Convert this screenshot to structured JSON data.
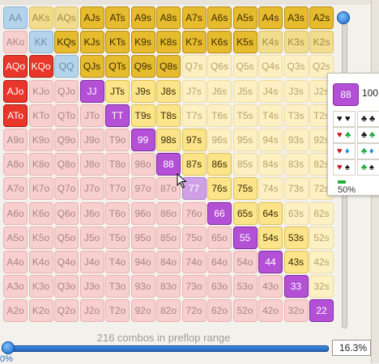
{
  "ranks": [
    "A",
    "K",
    "Q",
    "J",
    "T",
    "9",
    "8",
    "7",
    "6",
    "5",
    "4",
    "3",
    "2"
  ],
  "cells": [
    [
      [
        "AA",
        "blue",
        0
      ],
      [
        "AKs",
        "gold-faded",
        0
      ],
      [
        "AQs",
        "gold-faded",
        0
      ],
      [
        "AJs",
        "gold",
        0
      ],
      [
        "ATs",
        "gold",
        0
      ],
      [
        "A9s",
        "gold",
        0
      ],
      [
        "A8s",
        "gold",
        0
      ],
      [
        "A7s",
        "gold",
        0
      ],
      [
        "A6s",
        "gold",
        0
      ],
      [
        "A5s",
        "gold",
        1
      ],
      [
        "A4s",
        "gold",
        1
      ],
      [
        "A3s",
        "gold",
        1
      ],
      [
        "A2s",
        "gold",
        1
      ]
    ],
    [
      [
        "AKo",
        "pink",
        0
      ],
      [
        "KK",
        "blue",
        0
      ],
      [
        "KQs",
        "gold",
        1
      ],
      [
        "KJs",
        "gold",
        1
      ],
      [
        "KTs",
        "gold",
        1
      ],
      [
        "K9s",
        "gold",
        1
      ],
      [
        "K8s",
        "gold",
        1
      ],
      [
        "K7s",
        "gold",
        1
      ],
      [
        "K6s",
        "gold",
        1
      ],
      [
        "K5s",
        "gold",
        1
      ],
      [
        "K4s",
        "gold-faded",
        0
      ],
      [
        "K3s",
        "gold-faded",
        0
      ],
      [
        "K2s",
        "gold-faded",
        0
      ]
    ],
    [
      [
        "AQo",
        "raise",
        0
      ],
      [
        "KQo",
        "raise",
        0
      ],
      [
        "QQ",
        "blue",
        0
      ],
      [
        "QJs",
        "gold",
        1
      ],
      [
        "QTs",
        "gold",
        1
      ],
      [
        "Q9s",
        "gold",
        1
      ],
      [
        "Q8s",
        "gold",
        1
      ],
      [
        "Q7s",
        "yellow-faded",
        0
      ],
      [
        "Q6s",
        "yellow-faded",
        0
      ],
      [
        "Q5s",
        "yellow-faded",
        0
      ],
      [
        "Q4s",
        "yellow-faded",
        0
      ],
      [
        "Q3s",
        "yellow-faded",
        0
      ],
      [
        "Q2s",
        "yellow-faded",
        0
      ]
    ],
    [
      [
        "AJo",
        "raise",
        0
      ],
      [
        "KJo",
        "pink",
        0
      ],
      [
        "QJo",
        "pink",
        0
      ],
      [
        "JJ",
        "purple",
        0
      ],
      [
        "JTs",
        "yellow",
        1
      ],
      [
        "J9s",
        "yellow",
        1
      ],
      [
        "J8s",
        "yellow",
        1
      ],
      [
        "J7s",
        "yellow-faded",
        0
      ],
      [
        "J6s",
        "yellow-faded",
        0
      ],
      [
        "J5s",
        "yellow-faded",
        0
      ],
      [
        "J4s",
        "yellow-faded",
        0
      ],
      [
        "J3s",
        "yellow-faded",
        0
      ],
      [
        "J2s",
        "yellow-faded",
        0
      ]
    ],
    [
      [
        "ATo",
        "raise",
        0
      ],
      [
        "KTo",
        "pink",
        0
      ],
      [
        "QTo",
        "pink",
        0
      ],
      [
        "JTo",
        "pink",
        0
      ],
      [
        "TT",
        "purple",
        0
      ],
      [
        "T9s",
        "yellow",
        0
      ],
      [
        "T8s",
        "yellow",
        0
      ],
      [
        "T7s",
        "yellow-faded",
        0
      ],
      [
        "T6s",
        "yellow-faded",
        0
      ],
      [
        "T5s",
        "yellow-faded",
        0
      ],
      [
        "T4s",
        "yellow-faded",
        0
      ],
      [
        "T3s",
        "yellow-faded",
        0
      ],
      [
        "T2s",
        "yellow-faded",
        0
      ]
    ],
    [
      [
        "A9o",
        "pink",
        0
      ],
      [
        "K9o",
        "pink",
        0
      ],
      [
        "Q9o",
        "pink",
        0
      ],
      [
        "J9o",
        "pink",
        0
      ],
      [
        "T9o",
        "pink",
        0
      ],
      [
        "99",
        "purple",
        0
      ],
      [
        "98s",
        "yellow",
        0
      ],
      [
        "97s",
        "yellow",
        0
      ],
      [
        "96s",
        "yellow-faded",
        0
      ],
      [
        "95s",
        "yellow-faded",
        0
      ],
      [
        "94s",
        "yellow-faded",
        0
      ],
      [
        "93s",
        "yellow-faded",
        0
      ],
      [
        "92s",
        "yellow-faded",
        0
      ]
    ],
    [
      [
        "A8o",
        "pink",
        0
      ],
      [
        "K8o",
        "pink",
        0
      ],
      [
        "Q8o",
        "pink",
        0
      ],
      [
        "J8o",
        "pink",
        0
      ],
      [
        "T8o",
        "pink",
        0
      ],
      [
        "98o",
        "pink",
        0
      ],
      [
        "88",
        "purple",
        0
      ],
      [
        "87s",
        "yellow",
        0
      ],
      [
        "86s",
        "yellow",
        0
      ],
      [
        "85s",
        "yellow-faded",
        0
      ],
      [
        "84s",
        "yellow-faded",
        0
      ],
      [
        "83s",
        "yellow-faded",
        0
      ],
      [
        "82s",
        "yellow-faded",
        0
      ]
    ],
    [
      [
        "A7o",
        "pink",
        0
      ],
      [
        "K7o",
        "pink",
        0
      ],
      [
        "Q7o",
        "pink",
        0
      ],
      [
        "J7o",
        "pink",
        0
      ],
      [
        "T7o",
        "pink",
        0
      ],
      [
        "97o",
        "pink",
        0
      ],
      [
        "87o",
        "pink",
        0
      ],
      [
        "77",
        "purple-faded",
        0
      ],
      [
        "76s",
        "yellow",
        0
      ],
      [
        "75s",
        "yellow",
        0
      ],
      [
        "74s",
        "yellow-faded",
        0
      ],
      [
        "73s",
        "yellow-faded",
        0
      ],
      [
        "72s",
        "yellow-faded",
        0
      ]
    ],
    [
      [
        "A6o",
        "pink",
        0
      ],
      [
        "K6o",
        "pink",
        0
      ],
      [
        "Q6o",
        "pink",
        0
      ],
      [
        "J6o",
        "pink",
        0
      ],
      [
        "T6o",
        "pink",
        0
      ],
      [
        "96o",
        "pink",
        0
      ],
      [
        "86o",
        "pink",
        0
      ],
      [
        "76o",
        "pink",
        0
      ],
      [
        "66",
        "purple",
        0
      ],
      [
        "65s",
        "yellow",
        0
      ],
      [
        "64s",
        "yellow",
        0
      ],
      [
        "63s",
        "yellow-faded",
        0
      ],
      [
        "62s",
        "yellow-faded",
        0
      ]
    ],
    [
      [
        "A5o",
        "pink",
        0
      ],
      [
        "K5o",
        "pink",
        0
      ],
      [
        "Q5o",
        "pink",
        0
      ],
      [
        "J5o",
        "pink",
        0
      ],
      [
        "T5o",
        "pink",
        0
      ],
      [
        "95o",
        "pink",
        0
      ],
      [
        "85o",
        "pink",
        0
      ],
      [
        "75o",
        "pink",
        0
      ],
      [
        "65o",
        "pink",
        0
      ],
      [
        "55",
        "purple",
        0
      ],
      [
        "54s",
        "yellow",
        0
      ],
      [
        "53s",
        "yellow",
        0
      ],
      [
        "52s",
        "yellow-faded",
        0
      ]
    ],
    [
      [
        "A4o",
        "pink",
        0
      ],
      [
        "K4o",
        "pink",
        0
      ],
      [
        "Q4o",
        "pink",
        0
      ],
      [
        "J4o",
        "pink",
        0
      ],
      [
        "T4o",
        "pink",
        0
      ],
      [
        "94o",
        "pink",
        0
      ],
      [
        "84o",
        "pink",
        0
      ],
      [
        "74o",
        "pink",
        0
      ],
      [
        "64o",
        "pink",
        0
      ],
      [
        "54o",
        "pink",
        0
      ],
      [
        "44",
        "purple",
        0
      ],
      [
        "43s",
        "yellow",
        0
      ],
      [
        "42s",
        "yellow-faded",
        0
      ]
    ],
    [
      [
        "A3o",
        "pink",
        0
      ],
      [
        "K3o",
        "pink",
        0
      ],
      [
        "Q3o",
        "pink",
        0
      ],
      [
        "J3o",
        "pink",
        0
      ],
      [
        "T3o",
        "pink",
        0
      ],
      [
        "93o",
        "pink",
        0
      ],
      [
        "83o",
        "pink",
        0
      ],
      [
        "73o",
        "pink",
        0
      ],
      [
        "63o",
        "pink",
        0
      ],
      [
        "53o",
        "pink",
        0
      ],
      [
        "43o",
        "pink",
        0
      ],
      [
        "33",
        "purple",
        0
      ],
      [
        "32s",
        "yellow-faded",
        0
      ]
    ],
    [
      [
        "A2o",
        "pink",
        0
      ],
      [
        "K2o",
        "pink",
        0
      ],
      [
        "Q2o",
        "pink",
        0
      ],
      [
        "J2o",
        "pink",
        0
      ],
      [
        "T2o",
        "pink",
        0
      ],
      [
        "92o",
        "pink",
        0
      ],
      [
        "82o",
        "pink",
        0
      ],
      [
        "72o",
        "pink",
        0
      ],
      [
        "62o",
        "pink",
        0
      ],
      [
        "52o",
        "pink",
        0
      ],
      [
        "42o",
        "pink",
        0
      ],
      [
        "32o",
        "pink",
        0
      ],
      [
        "22",
        "purple",
        0
      ]
    ]
  ],
  "caption": "216 combos in preflop range",
  "slider": {
    "value_text": "16.3%",
    "min_label": "0%",
    "fraction": 0.163
  },
  "popup": {
    "hand": "88",
    "percent": "100",
    "freq_label": "50%",
    "suit_combos": [
      {
        "a": "♥",
        "ac": "blk",
        "b": "♥",
        "bc": "blk"
      },
      {
        "a": "♣",
        "ac": "blk",
        "b": "♣",
        "bc": "blk"
      },
      {
        "a": "♥",
        "ac": "red",
        "b": "♣",
        "bc": "grn"
      },
      {
        "a": "♣",
        "ac": "blk",
        "b": "♣",
        "bc": "grn"
      },
      {
        "a": "♥",
        "ac": "red",
        "b": "♦",
        "bc": "blu"
      },
      {
        "a": "♣",
        "ac": "grn",
        "b": "♦",
        "bc": "blu"
      },
      {
        "a": "♥",
        "ac": "red",
        "b": "♠",
        "bc": "blk"
      },
      {
        "a": "♣",
        "ac": "grn",
        "b": "♠",
        "bc": "blk"
      }
    ]
  },
  "colors": {
    "raise": "#e8362a",
    "blue": "#b3d3ea",
    "gold": "#e7bb2e",
    "yellow": "#fbe48a",
    "purple": "#b350d6",
    "pink": "#f7cfcf",
    "bar_green": "#23b53a",
    "accent": "#1767c9"
  }
}
